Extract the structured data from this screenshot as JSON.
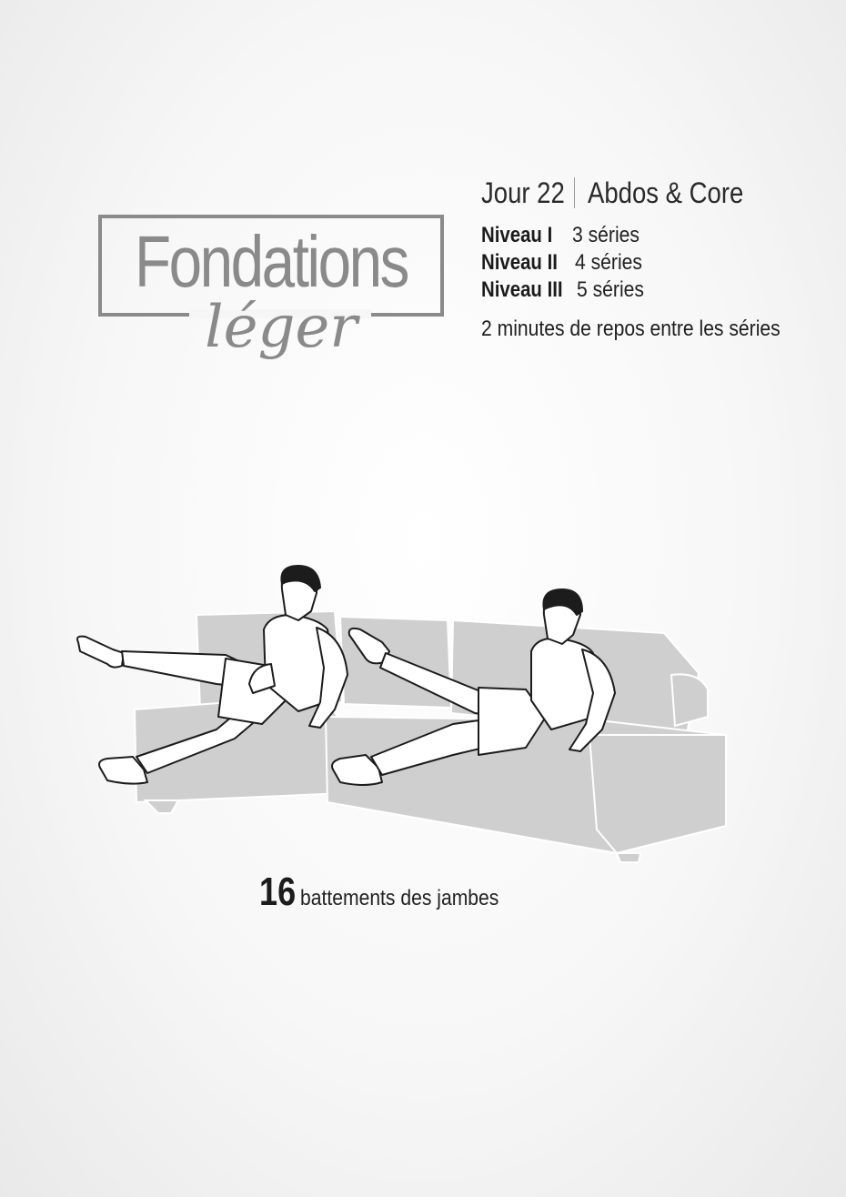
{
  "logo": {
    "title": "Fondations",
    "subtitle": "léger"
  },
  "header": {
    "day": "Jour 22",
    "category": "Abdos & Core"
  },
  "levels": [
    {
      "name": "Niveau I",
      "sets": "3 séries"
    },
    {
      "name": "Niveau II",
      "sets": "4 séries"
    },
    {
      "name": "Niveau III",
      "sets": "5 séries"
    }
  ],
  "rest_note": "2 minutes de repos entre les séries",
  "exercise": {
    "reps": "16",
    "label": "battements des jambes",
    "illustration": "couch-flutter-kicks-illustration"
  },
  "colors": {
    "logo_gray": "#8a8a8a",
    "couch_gray": "#cfcfcf",
    "text": "#1c1c1c"
  }
}
